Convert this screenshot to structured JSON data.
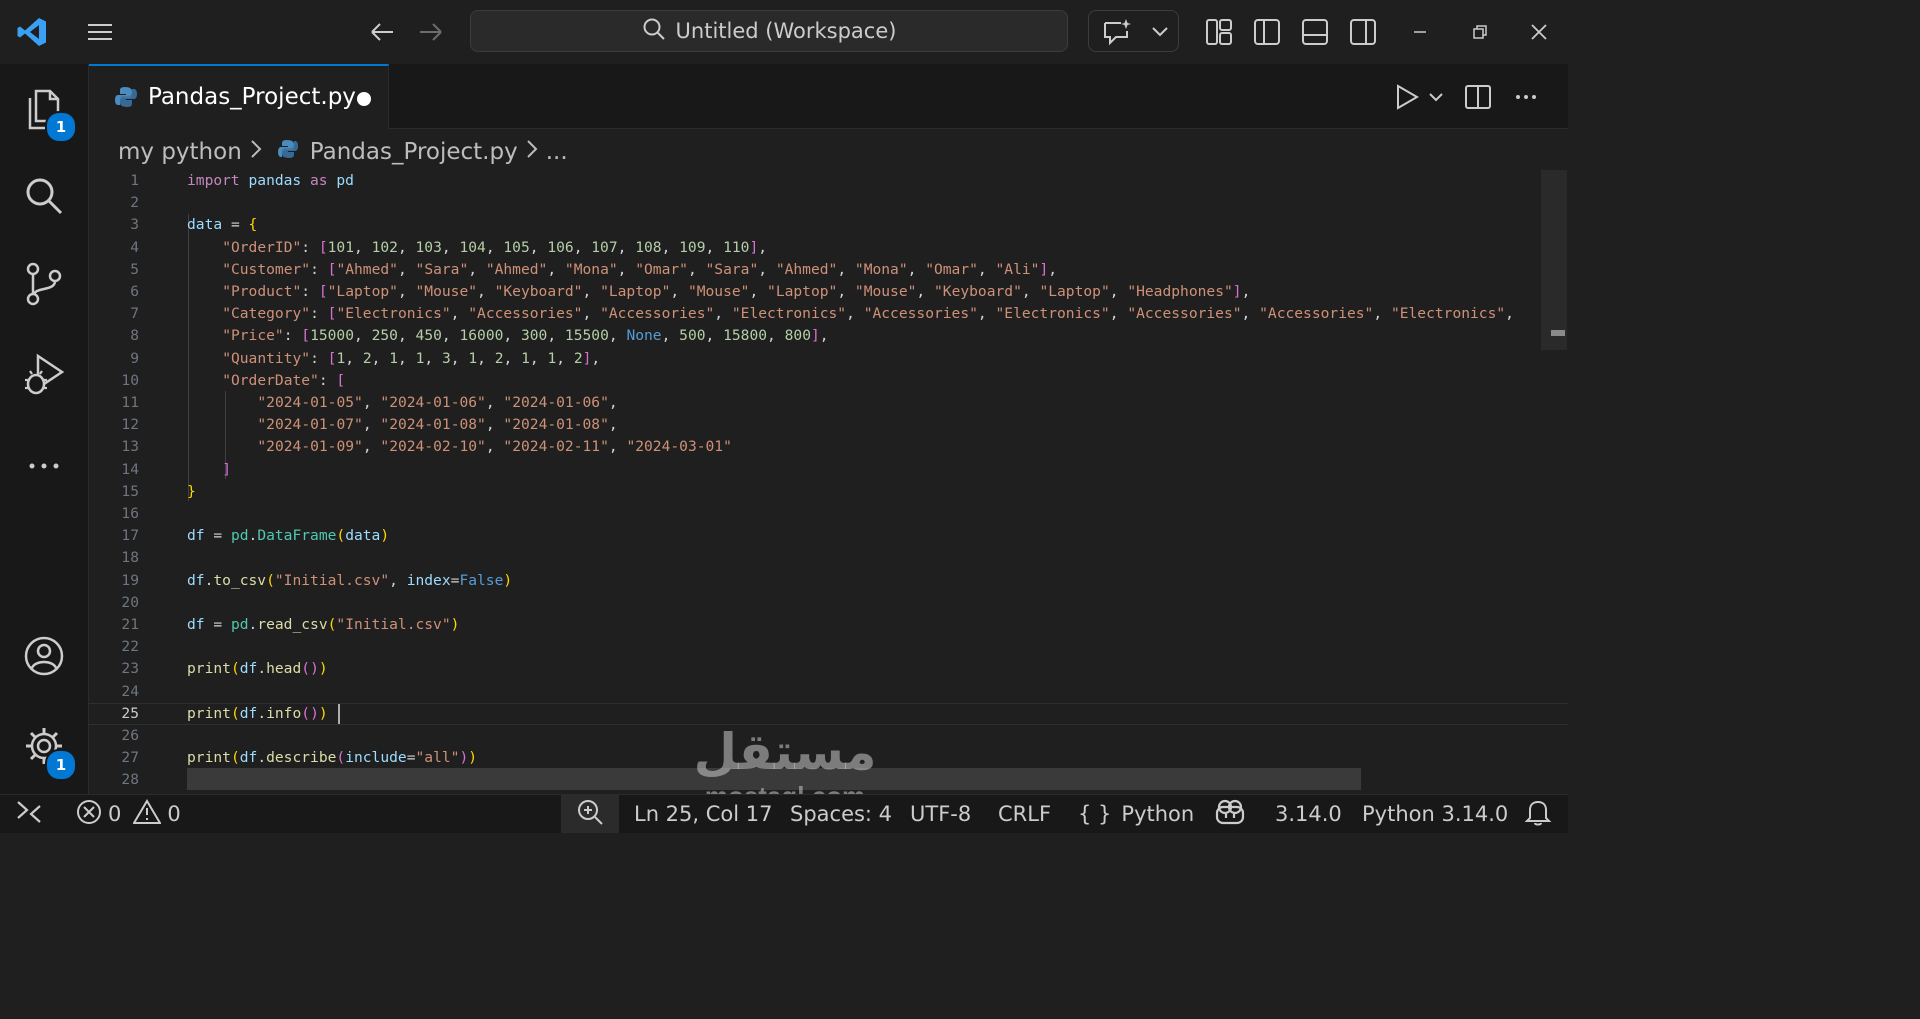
{
  "titlebar": {
    "search_text": "Untitled (Workspace)"
  },
  "activity": {
    "explorer_badge": "1",
    "settings_badge": "1"
  },
  "tab": {
    "filename": "Pandas_Project.py"
  },
  "breadcrumb": {
    "folder": "my python",
    "file": "Pandas_Project.py",
    "more": "..."
  },
  "editor": {
    "line_numbers": [
      "1",
      "2",
      "3",
      "4",
      "5",
      "6",
      "7",
      "8",
      "9",
      "10",
      "11",
      "12",
      "13",
      "14",
      "15",
      "16",
      "17",
      "18",
      "19",
      "20",
      "21",
      "22",
      "23",
      "24",
      "25",
      "26",
      "27",
      "28"
    ],
    "active_line": "25",
    "tokens": {
      "l1": [
        "import",
        " pandas ",
        "as",
        " pd"
      ],
      "l3": [
        "data",
        " = ",
        "{"
      ],
      "l4": [
        "\"OrderID\"",
        ": ",
        "[",
        "101",
        ", ",
        "102",
        ", ",
        "103",
        ", ",
        "104",
        ", ",
        "105",
        ", ",
        "106",
        ", ",
        "107",
        ", ",
        "108",
        ", ",
        "109",
        ", ",
        "110",
        "]",
        ","
      ],
      "l5": [
        "\"Customer\"",
        ": ",
        "[",
        "\"Ahmed\"",
        ", ",
        "\"Sara\"",
        ", ",
        "\"Ahmed\"",
        ", ",
        "\"Mona\"",
        ", ",
        "\"Omar\"",
        ", ",
        "\"Sara\"",
        ", ",
        "\"Ahmed\"",
        ", ",
        "\"Mona\"",
        ", ",
        "\"Omar\"",
        ", ",
        "\"Ali\"",
        "]",
        ","
      ],
      "l6": [
        "\"Product\"",
        ": ",
        "[",
        "\"Laptop\"",
        ", ",
        "\"Mouse\"",
        ", ",
        "\"Keyboard\"",
        ", ",
        "\"Laptop\"",
        ", ",
        "\"Mouse\"",
        ", ",
        "\"Laptop\"",
        ", ",
        "\"Mouse\"",
        ", ",
        "\"Keyboard\"",
        ", ",
        "\"Laptop\"",
        ", ",
        "\"Headphones\"",
        "]",
        ","
      ],
      "l7": [
        "\"Category\"",
        ": ",
        "[",
        "\"Electronics\"",
        ", ",
        "\"Accessories\"",
        ", ",
        "\"Accessories\"",
        ", ",
        "\"Electronics\"",
        ", ",
        "\"Accessories\"",
        ", ",
        "\"Electronics\"",
        ", ",
        "\"Accessories\"",
        ", ",
        "\"Accessories\"",
        ", ",
        "\"Electronics\"",
        ","
      ],
      "l8": [
        "\"Price\"",
        ": ",
        "[",
        "15000",
        ", ",
        "250",
        ", ",
        "450",
        ", ",
        "16000",
        ", ",
        "300",
        ", ",
        "15500",
        ", ",
        "None",
        ", ",
        "500",
        ", ",
        "15800",
        ", ",
        "800",
        "]",
        ","
      ],
      "l9": [
        "\"Quantity\"",
        ": ",
        "[",
        "1",
        ", ",
        "2",
        ", ",
        "1",
        ", ",
        "1",
        ", ",
        "3",
        ", ",
        "1",
        ", ",
        "2",
        ", ",
        "1",
        ", ",
        "1",
        ", ",
        "2",
        "]",
        ","
      ],
      "l10": [
        "\"OrderDate\"",
        ": ",
        "["
      ],
      "l11": [
        "\"2024-01-05\"",
        ", ",
        "\"2024-01-06\"",
        ", ",
        "\"2024-01-06\"",
        ","
      ],
      "l12": [
        "\"2024-01-07\"",
        ", ",
        "\"2024-01-08\"",
        ", ",
        "\"2024-01-08\"",
        ","
      ],
      "l13": [
        "\"2024-01-09\"",
        ", ",
        "\"2024-02-10\"",
        ", ",
        "\"2024-02-11\"",
        ", ",
        "\"2024-03-01\""
      ],
      "l14": [
        "]"
      ],
      "l15": [
        "}"
      ],
      "l17": [
        "df",
        " = ",
        "pd",
        ".",
        "DataFrame",
        "(",
        "data",
        ")"
      ],
      "l19": [
        "df",
        ".",
        "to_csv",
        "(",
        "\"Initial.csv\"",
        ", ",
        "index",
        "=",
        "False",
        ")"
      ],
      "l21": [
        "df",
        " = ",
        "pd",
        ".",
        "read_csv",
        "(",
        "\"Initial.csv\"",
        ")"
      ],
      "l23": [
        "print",
        "(",
        "df",
        ".",
        "head",
        "(",
        ")",
        ")"
      ],
      "l25": [
        "print",
        "(",
        "df",
        ".",
        "info",
        "(",
        ")",
        ")"
      ],
      "l27": [
        "print",
        "(",
        "df",
        ".",
        "describe",
        "(",
        "include",
        "=",
        "\"all\"",
        ")",
        ")"
      ]
    }
  },
  "statusbar": {
    "errors": "0",
    "warnings": "0",
    "position": "Ln 25, Col 17",
    "spaces": "Spaces: 4",
    "encoding": "UTF-8",
    "eol": "CRLF",
    "lang_braces": "{ }",
    "language": "Python",
    "version": "3.14.0",
    "interpreter": "Python 3.14.0"
  },
  "watermark": {
    "arabic": "مستقل",
    "latin": "mostaql.com"
  },
  "colors": {
    "accent": "#0078d4",
    "background": "#1f1f1f",
    "sidebar": "#181818"
  }
}
